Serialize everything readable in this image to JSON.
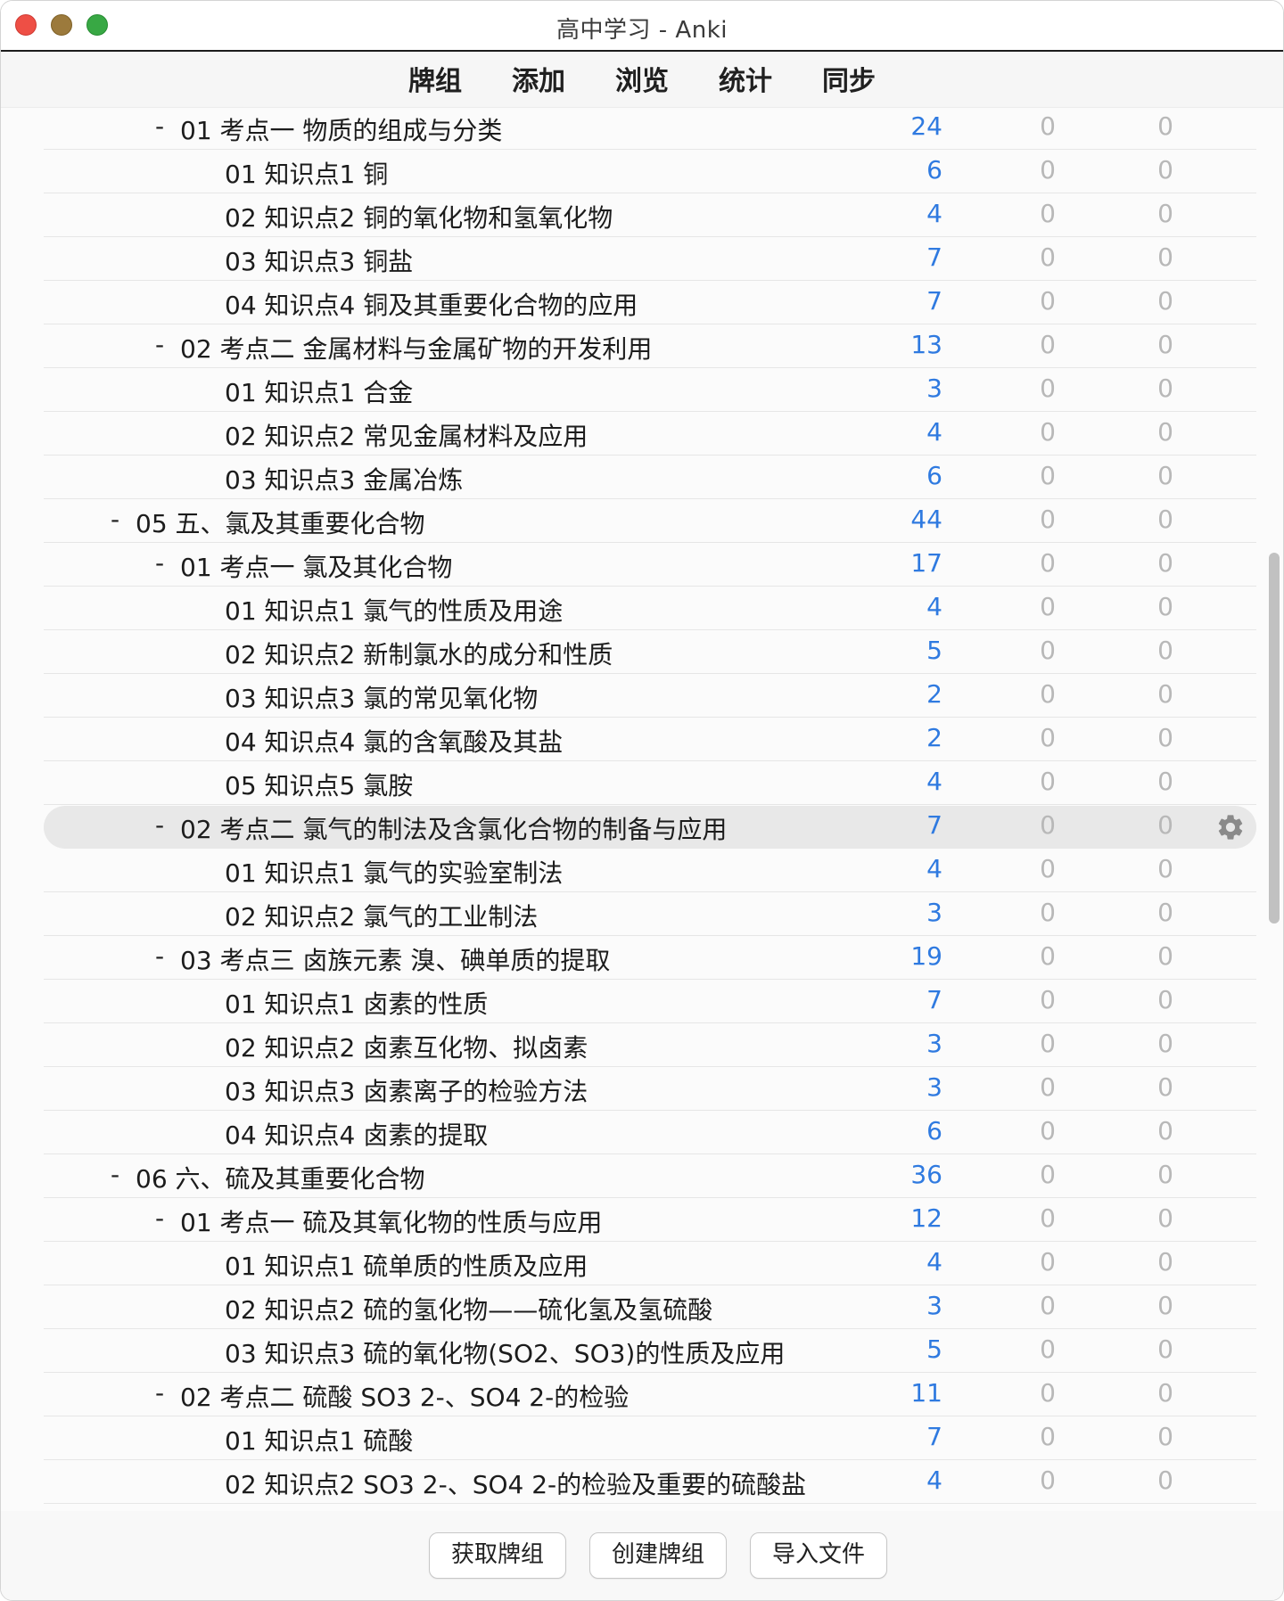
{
  "window": {
    "title": "高中学习 - Anki"
  },
  "toolbar": {
    "items": [
      "牌组",
      "添加",
      "浏览",
      "统计",
      "同步"
    ]
  },
  "colors": {
    "new": "#2f7ae0",
    "zero": "#b8b8b8",
    "current_row": "#e8e8e8"
  },
  "decks": [
    {
      "level": 2,
      "collapse": "-",
      "name": "01 考点一 物质的组成与分类",
      "new": "24",
      "learn": "0",
      "due": "0"
    },
    {
      "level": 3,
      "collapse": "",
      "name": "01 知识点1 铜",
      "new": "6",
      "learn": "0",
      "due": "0"
    },
    {
      "level": 3,
      "collapse": "",
      "name": "02 知识点2 铜的氧化物和氢氧化物",
      "new": "4",
      "learn": "0",
      "due": "0"
    },
    {
      "level": 3,
      "collapse": "",
      "name": "03 知识点3 铜盐",
      "new": "7",
      "learn": "0",
      "due": "0"
    },
    {
      "level": 3,
      "collapse": "",
      "name": "04 知识点4 铜及其重要化合物的应用",
      "new": "7",
      "learn": "0",
      "due": "0"
    },
    {
      "level": 2,
      "collapse": "-",
      "name": "02 考点二 金属材料与金属矿物的开发利用",
      "new": "13",
      "learn": "0",
      "due": "0"
    },
    {
      "level": 3,
      "collapse": "",
      "name": "01 知识点1 合金",
      "new": "3",
      "learn": "0",
      "due": "0"
    },
    {
      "level": 3,
      "collapse": "",
      "name": "02 知识点2 常见金属材料及应用",
      "new": "4",
      "learn": "0",
      "due": "0"
    },
    {
      "level": 3,
      "collapse": "",
      "name": "03 知识点3 金属冶炼",
      "new": "6",
      "learn": "0",
      "due": "0"
    },
    {
      "level": 1,
      "collapse": "-",
      "name": "05 五、氯及其重要化合物",
      "new": "44",
      "learn": "0",
      "due": "0"
    },
    {
      "level": 2,
      "collapse": "-",
      "name": "01 考点一 氯及其化合物",
      "new": "17",
      "learn": "0",
      "due": "0"
    },
    {
      "level": 3,
      "collapse": "",
      "name": "01 知识点1 氯气的性质及用途",
      "new": "4",
      "learn": "0",
      "due": "0"
    },
    {
      "level": 3,
      "collapse": "",
      "name": "02 知识点2 新制氯水的成分和性质",
      "new": "5",
      "learn": "0",
      "due": "0"
    },
    {
      "level": 3,
      "collapse": "",
      "name": "03 知识点3 氯的常见氧化物",
      "new": "2",
      "learn": "0",
      "due": "0"
    },
    {
      "level": 3,
      "collapse": "",
      "name": "04 知识点4 氯的含氧酸及其盐",
      "new": "2",
      "learn": "0",
      "due": "0"
    },
    {
      "level": 3,
      "collapse": "",
      "name": "05 知识点5 氯胺",
      "new": "4",
      "learn": "0",
      "due": "0"
    },
    {
      "level": 2,
      "collapse": "-",
      "name": "02 考点二 氯气的制法及含氯化合物的制备与应用",
      "new": "7",
      "learn": "0",
      "due": "0",
      "current": true
    },
    {
      "level": 3,
      "collapse": "",
      "name": "01 知识点1 氯气的实验室制法",
      "new": "4",
      "learn": "0",
      "due": "0"
    },
    {
      "level": 3,
      "collapse": "",
      "name": "02 知识点2 氯气的工业制法",
      "new": "3",
      "learn": "0",
      "due": "0"
    },
    {
      "level": 2,
      "collapse": "-",
      "name": "03 考点三 卤族元素 溴、碘单质的提取",
      "new": "19",
      "learn": "0",
      "due": "0"
    },
    {
      "level": 3,
      "collapse": "",
      "name": "01 知识点1 卤素的性质",
      "new": "7",
      "learn": "0",
      "due": "0"
    },
    {
      "level": 3,
      "collapse": "",
      "name": "02 知识点2 卤素互化物、拟卤素",
      "new": "3",
      "learn": "0",
      "due": "0"
    },
    {
      "level": 3,
      "collapse": "",
      "name": "03 知识点3 卤素离子的检验方法",
      "new": "3",
      "learn": "0",
      "due": "0"
    },
    {
      "level": 3,
      "collapse": "",
      "name": "04 知识点4 卤素的提取",
      "new": "6",
      "learn": "0",
      "due": "0"
    },
    {
      "level": 1,
      "collapse": "-",
      "name": "06 六、硫及其重要化合物",
      "new": "36",
      "learn": "0",
      "due": "0"
    },
    {
      "level": 2,
      "collapse": "-",
      "name": "01 考点一 硫及其氧化物的性质与应用",
      "new": "12",
      "learn": "0",
      "due": "0"
    },
    {
      "level": 3,
      "collapse": "",
      "name": "01 知识点1 硫单质的性质及应用",
      "new": "4",
      "learn": "0",
      "due": "0"
    },
    {
      "level": 3,
      "collapse": "",
      "name": "02 知识点2 硫的氢化物——硫化氢及氢硫酸",
      "new": "3",
      "learn": "0",
      "due": "0"
    },
    {
      "level": 3,
      "collapse": "",
      "name": "03 知识点3 硫的氧化物(SO2、SO3)的性质及应用",
      "new": "5",
      "learn": "0",
      "due": "0"
    },
    {
      "level": 2,
      "collapse": "-",
      "name": "02 考点二 硫酸 SO3 2-、SO4 2-的检验",
      "new": "11",
      "learn": "0",
      "due": "0"
    },
    {
      "level": 3,
      "collapse": "",
      "name": "01 知识点1 硫酸",
      "new": "7",
      "learn": "0",
      "due": "0"
    },
    {
      "level": 3,
      "collapse": "",
      "name": "02 知识点2 SO3 2-、SO4 2-的检验及重要的硫酸盐",
      "new": "4",
      "learn": "0",
      "due": "0"
    }
  ],
  "bottom_buttons": {
    "get_shared": "获取牌组",
    "create_deck": "创建牌组",
    "import_file": "导入文件"
  },
  "icons": {
    "options": "gear-icon"
  }
}
